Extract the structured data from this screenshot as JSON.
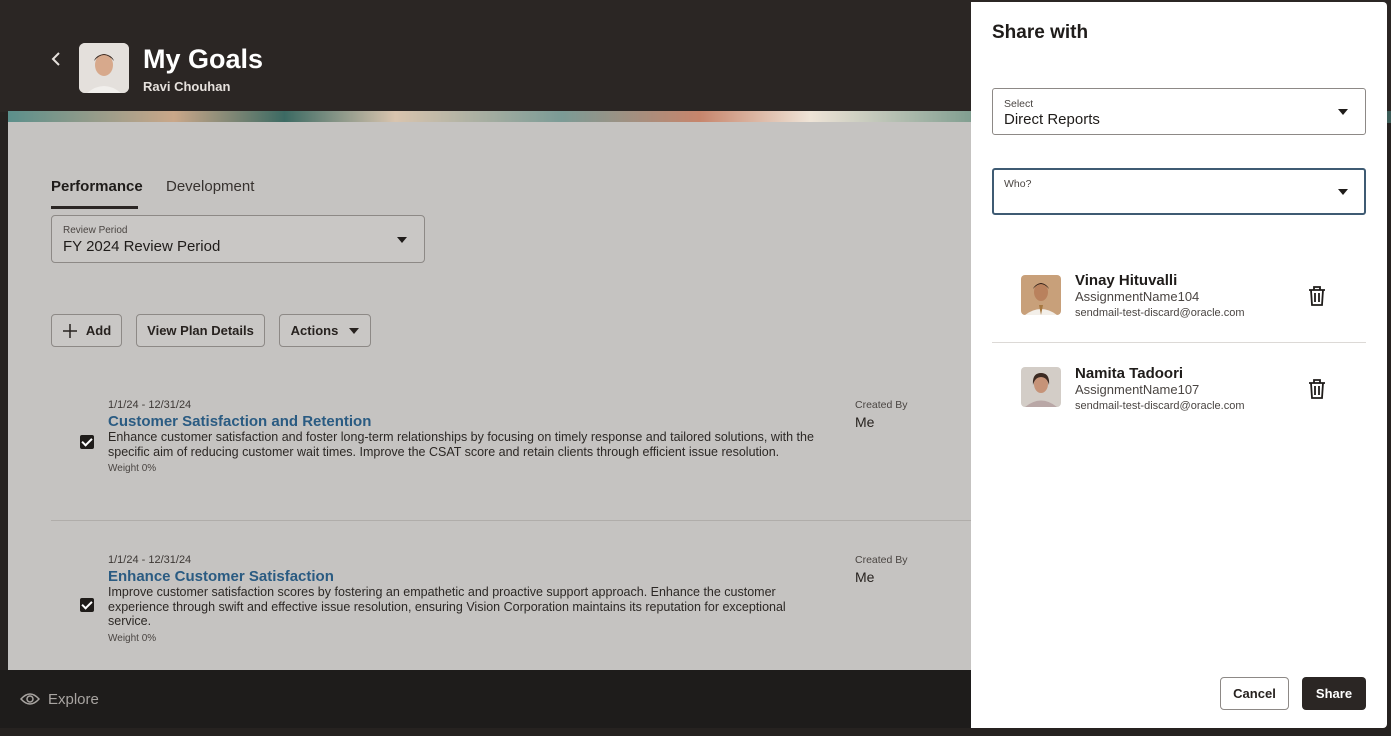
{
  "header": {
    "title": "My Goals",
    "user_name": "Ravi Chouhan"
  },
  "tabs": [
    {
      "label": "Performance",
      "active": true
    },
    {
      "label": "Development",
      "active": false
    }
  ],
  "review_period": {
    "label": "Review Period",
    "value": "FY 2024 Review Period"
  },
  "toolbar": {
    "add_label": "Add",
    "view_plan_label": "View Plan Details",
    "actions_label": "Actions"
  },
  "goals": [
    {
      "dates": "1/1/24 - 12/31/24",
      "title": "Customer Satisfaction and Retention",
      "description": "Enhance customer satisfaction and foster long-term relationships by focusing on timely response and tailored solutions, with the specific aim of reducing customer wait times. Improve the CSAT score and retain clients through efficient issue resolution.",
      "weight": "Weight 0%",
      "created_by_label": "Created By",
      "created_by": "Me",
      "checked": true
    },
    {
      "dates": "1/1/24 - 12/31/24",
      "title": "Enhance Customer Satisfaction",
      "description": "Improve customer satisfaction scores by fostering an empathetic and proactive support approach. Enhance the customer experience through swift and effective issue resolution, ensuring Vision Corporation maintains its reputation for exceptional service.",
      "weight": "Weight 0%",
      "created_by_label": "Created By",
      "created_by": "Me",
      "checked": true
    }
  ],
  "footer": {
    "explore_label": "Explore"
  },
  "share_panel": {
    "title": "Share with",
    "select_label": "Select",
    "select_value": "Direct Reports",
    "who_label": "Who?",
    "who_value": "",
    "people": [
      {
        "name": "Vinay Hituvalli",
        "assignment": "AssignmentName104",
        "email": "sendmail-test-discard@oracle.com"
      },
      {
        "name": "Namita Tadoori",
        "assignment": "AssignmentName107",
        "email": "sendmail-test-discard@oracle.com"
      }
    ],
    "cancel_label": "Cancel",
    "share_label": "Share"
  },
  "colors": {
    "accent_dark": "#2b2624",
    "link_blue": "#2a5b82",
    "focus_border": "#3f5b73"
  }
}
